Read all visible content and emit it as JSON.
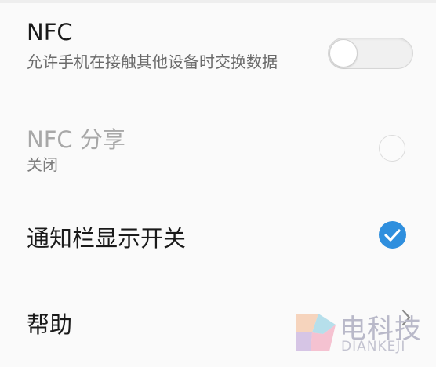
{
  "settings": {
    "nfc": {
      "title": "NFC",
      "description": "允许手机在接触其他设备时交换数据",
      "enabled": false
    },
    "nfc_share": {
      "title": "NFC 分享",
      "status": "关闭",
      "selected": false
    },
    "notification_switch": {
      "title": "通知栏显示开关",
      "checked": true
    },
    "help": {
      "title": "帮助"
    }
  },
  "watermark": {
    "brand": "电科技",
    "sub": "DIANKEJI"
  },
  "colors": {
    "accent": "#2f8fde",
    "title": "#1a1a1a",
    "disabled_title": "#a8a8a8",
    "subtitle": "#6a6a6a"
  },
  "icons": {
    "toggle": "switch-off",
    "nfc_share_indicator": "empty-circle",
    "notification_indicator": "check-circle",
    "help_indicator": "chevron-right"
  }
}
